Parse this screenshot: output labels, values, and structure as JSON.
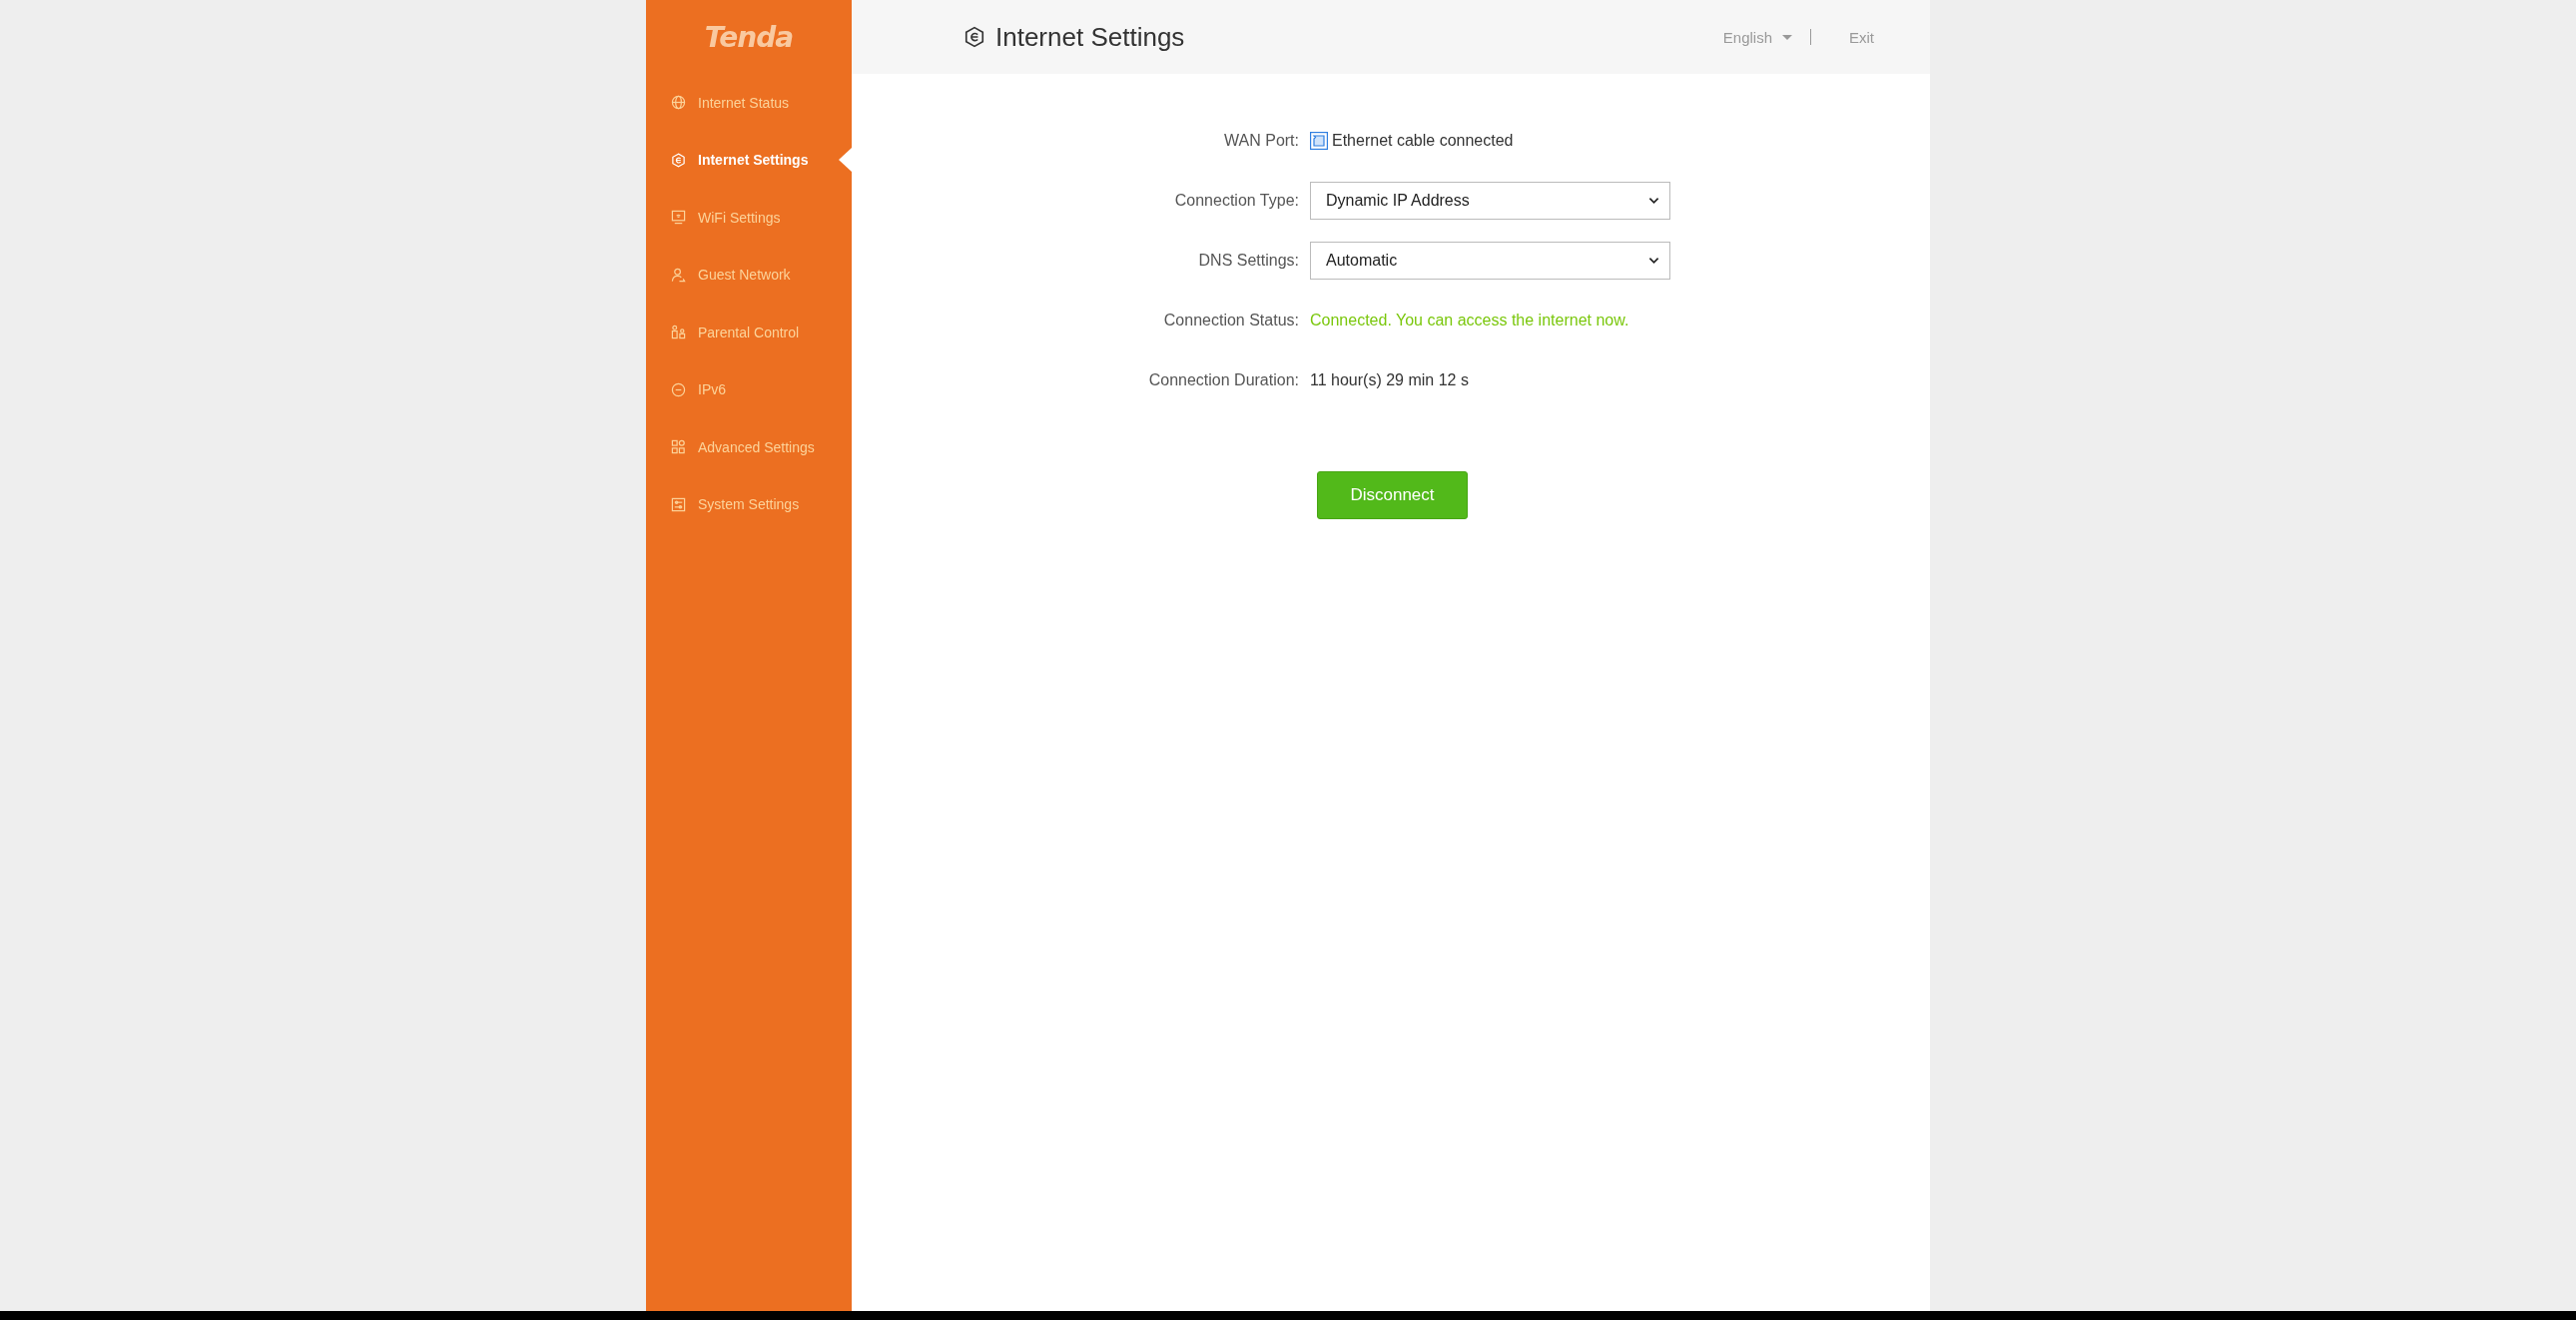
{
  "logo": "Tenda",
  "sidebar": {
    "items": [
      {
        "label": "Internet Status",
        "kind": "globe",
        "selected": false
      },
      {
        "label": "Internet Settings",
        "kind": "hex",
        "selected": true
      },
      {
        "label": "WiFi Settings",
        "kind": "monitor",
        "selected": false
      },
      {
        "label": "Guest Network",
        "kind": "person",
        "selected": false
      },
      {
        "label": "Parental Control",
        "kind": "family",
        "selected": false
      },
      {
        "label": "IPv6",
        "kind": "ipv6",
        "selected": false
      },
      {
        "label": "Advanced Settings",
        "kind": "grid",
        "selected": false
      },
      {
        "label": "System Settings",
        "kind": "sliders",
        "selected": false
      }
    ]
  },
  "header": {
    "title": "Internet Settings",
    "language": "English",
    "exit": "Exit"
  },
  "form": {
    "rows": [
      {
        "kind": "port",
        "label": "WAN Port:",
        "value": "Ethernet cable connected"
      },
      {
        "kind": "select",
        "label": "Connection Type:",
        "value": "Dynamic IP Address"
      },
      {
        "kind": "select",
        "label": "DNS Settings:",
        "value": "Automatic"
      },
      {
        "kind": "status",
        "label": "Connection Status:",
        "value": "Connected. You can access the internet now."
      },
      {
        "kind": "text",
        "label": "Connection Duration:",
        "value": "11 hour(s) 29 min 12 s"
      }
    ],
    "button": "Disconnect"
  }
}
